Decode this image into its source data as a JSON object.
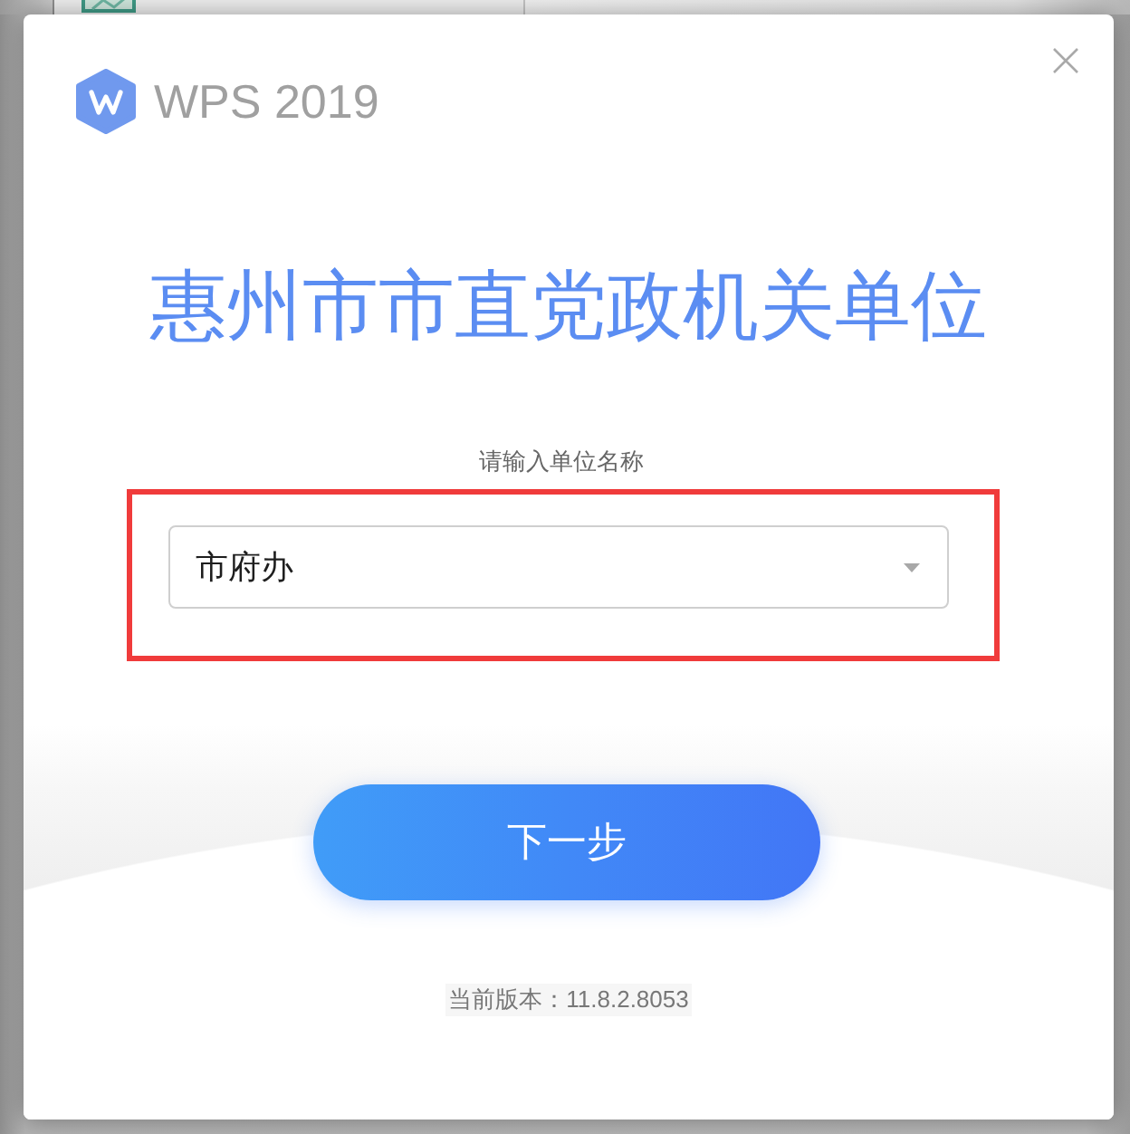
{
  "dialog": {
    "brand": "WPS 2019",
    "title": "惠州市市直党政机关单位",
    "unit_field": {
      "label": "请输入单位名称",
      "value": "市府办"
    },
    "next_button": "下一步",
    "version": "当前版本：11.8.2.8053"
  }
}
